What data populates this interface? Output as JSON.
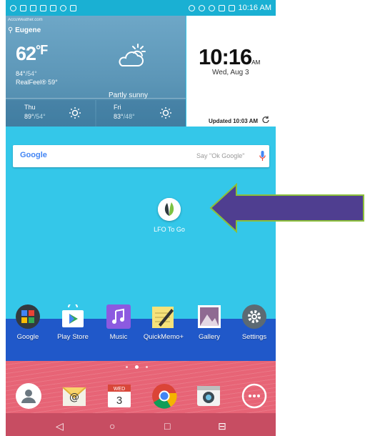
{
  "status": {
    "time": "10:16 AM"
  },
  "weather": {
    "source": "AccuWeather.com",
    "city": "Eugene",
    "temp": "62",
    "unit": "°F",
    "hi": "84°",
    "lo": "/54°",
    "realfeel": "RealFeel® 59°",
    "condition": "Partly sunny",
    "forecast": [
      {
        "day": "Thu",
        "hi": "89°",
        "lo": "/54°"
      },
      {
        "day": "Fri",
        "hi": "83°",
        "lo": "/48°"
      }
    ]
  },
  "clock": {
    "time": "10:16",
    "ampm": "AM",
    "date": "Wed, Aug 3",
    "updated": "Updated 10:03 AM"
  },
  "search": {
    "logo": "Google",
    "hint": "Say \"Ok Google\""
  },
  "shortcut": {
    "label": "LFO To Go"
  },
  "apps": [
    {
      "label": "Google"
    },
    {
      "label": "Play Store"
    },
    {
      "label": "Music"
    },
    {
      "label": "QuickMemo+"
    },
    {
      "label": "Gallery"
    },
    {
      "label": "Settings"
    }
  ],
  "dock": {
    "calendar_month": "WED",
    "calendar_day": "3"
  },
  "colors": {
    "accent": "#34c7e9",
    "statusbar": "#1ab0d3",
    "arrow": "#4f3e90",
    "arrow_outline": "#8bbf3a"
  }
}
